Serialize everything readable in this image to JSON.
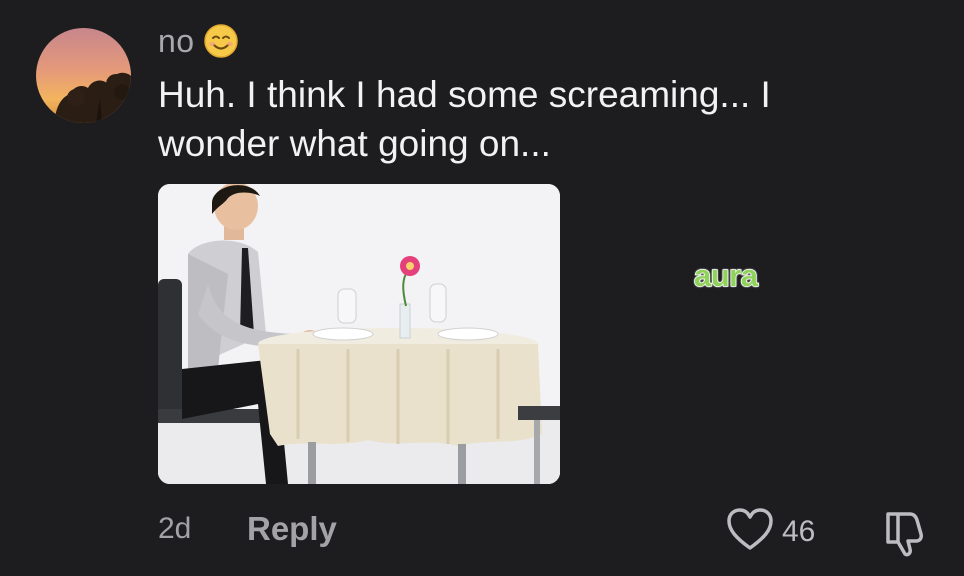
{
  "comment": {
    "username": "no",
    "username_emoji_icon": "smiling-face-icon",
    "text": "Huh. I think I had some screaming... I wonder what going on...",
    "image_description_icon": "man-at-table-photo"
  },
  "sticker": {
    "text": "aura",
    "color": "#8fd35a"
  },
  "footer": {
    "time": "2d",
    "reply_label": "Reply",
    "like_count": "46",
    "like_icon": "heart-icon",
    "dislike_icon": "thumbs-down-icon"
  },
  "colors": {
    "background": "#1d1c1f",
    "muted_text": "#a3a2a7",
    "primary_text": "#f2f2f2",
    "emoji_yellow": "#f7c948"
  }
}
